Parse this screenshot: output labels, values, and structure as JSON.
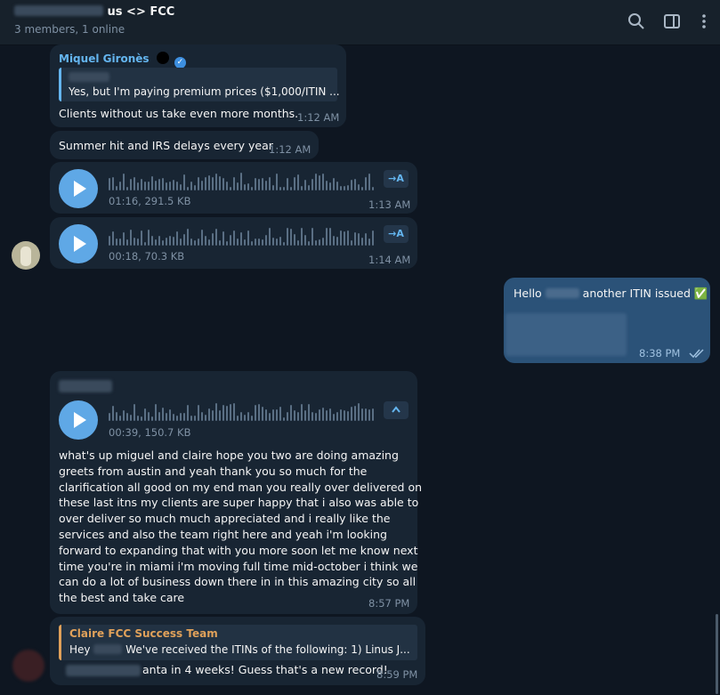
{
  "header": {
    "title_suffix": "us <> FCC",
    "subtitle": "3 members, 1 online",
    "icons": [
      "search-icon",
      "sidebar-toggle-icon",
      "more-vert-icon"
    ]
  },
  "messages": {
    "m1": {
      "sender": "Miquel Gironès",
      "quote_text": "Yes, but I'm paying premium prices ($1,000/ITIN ...",
      "text": "Clients without us take even more months.",
      "time": "1:12 AM"
    },
    "m2": {
      "text": "Summer hit and IRS delays every year",
      "time": "1:12 AM"
    },
    "v1": {
      "meta": "01:16, 291.5 KB",
      "time": "1:13 AM",
      "transcribe": "→A"
    },
    "v2": {
      "meta": "00:18, 70.3 KB",
      "time": "1:14 AM",
      "transcribe": "→A"
    },
    "out1": {
      "text_start": "Hello",
      "text_end": "another ITIN issued ✅",
      "time": "8:38 PM"
    },
    "v3": {
      "meta": "00:39, 150.7 KB",
      "time": "8:57 PM",
      "transcript": [
        "what's up miguel and claire hope you two are doing amazing",
        "greets from austin and yeah thank you so much for the",
        "clarification all good on my end man you really over delivered on",
        "these last itns my clients are super happy that i also was able to",
        "over deliver so much much appreciated and i really like the",
        "services and also the team right here and yeah i'm looking",
        "forward to expanding that with you more soon let me know next",
        "time you're in miami i'm moving full time mid-october i think we",
        "can do a lot of business down there in in this amazing city so all",
        "the best and take care"
      ]
    },
    "m5": {
      "quote_sender": "Claire FCC Success Team",
      "quote_start": "Hey",
      "quote_end": "We've received the ITINs of the following:  1) Linus J...",
      "text": "anta in 4 weeks! Guess that's a new record!",
      "time": "8:59 PM"
    }
  },
  "colors": {
    "background": "#0e1621",
    "incoming": "#182533",
    "outgoing": "#2b5278",
    "accent": "#64b5ef",
    "quote_accent": "#e0a15a"
  }
}
